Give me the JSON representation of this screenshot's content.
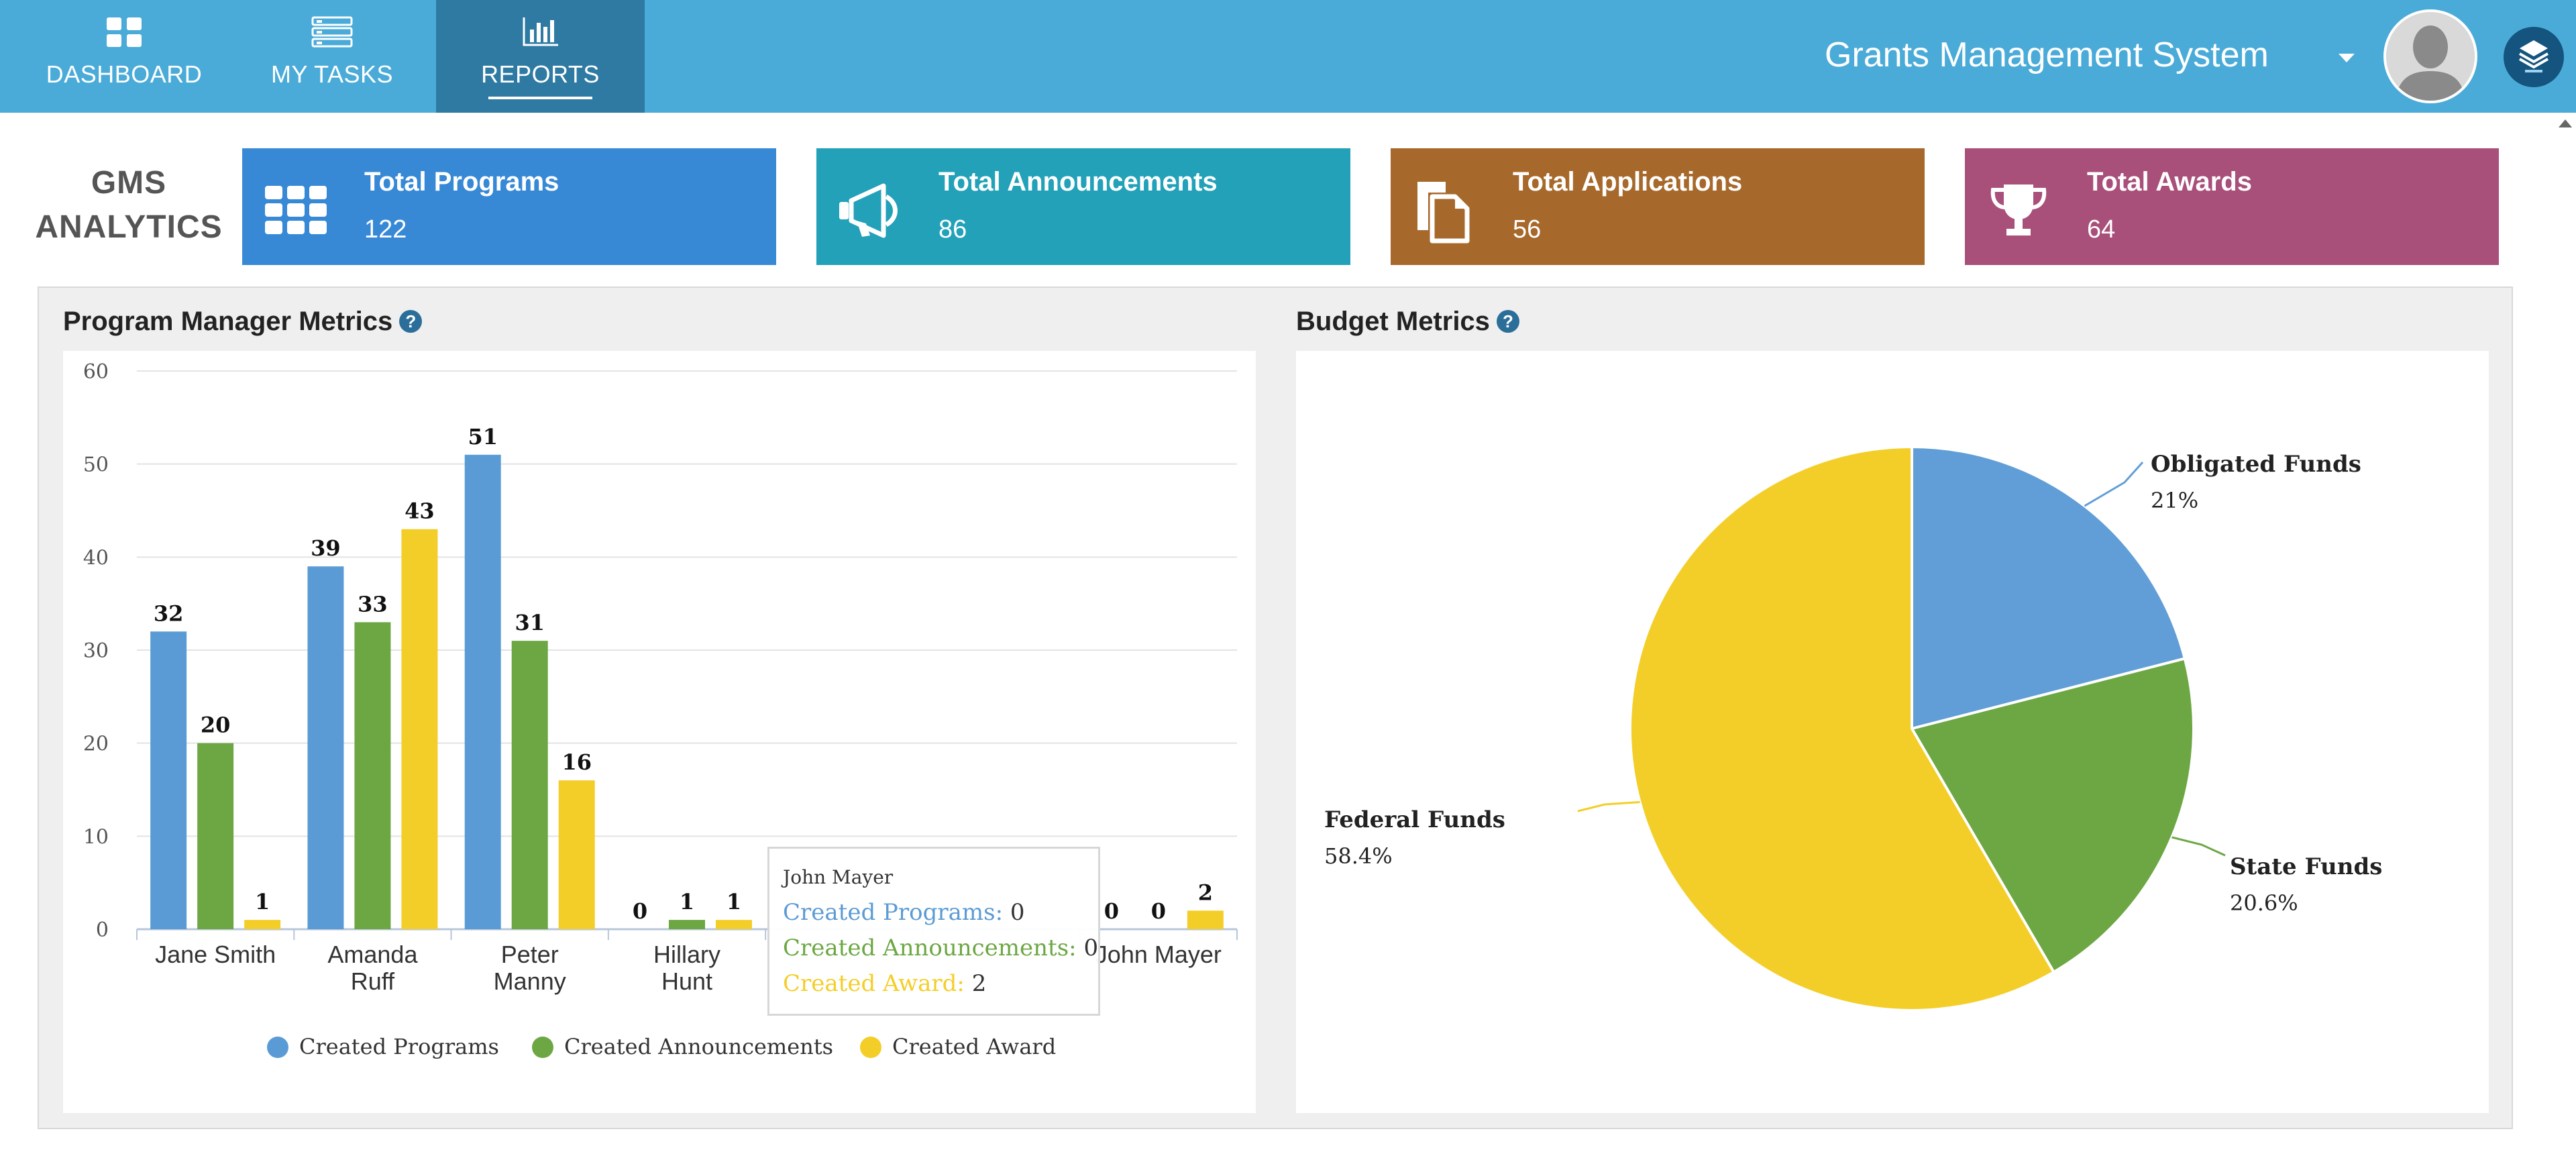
{
  "nav": {
    "items": [
      {
        "label": "DASHBOARD",
        "icon": "dashboard-grid-icon",
        "active": false
      },
      {
        "label": "MY TASKS",
        "icon": "task-list-icon",
        "active": false
      },
      {
        "label": "REPORTS",
        "icon": "bar-chart-icon",
        "active": true
      }
    ],
    "app_title": "Grants Management System"
  },
  "analytics": {
    "heading_line1": "GMS",
    "heading_line2": "ANALYTICS",
    "tiles": [
      {
        "title": "Total Programs",
        "value": "122",
        "icon": "grid-icon",
        "color": "#3789d6"
      },
      {
        "title": "Total Announcements",
        "value": "86",
        "icon": "megaphone-icon",
        "color": "#22a1b9"
      },
      {
        "title": "Total Applications",
        "value": "56",
        "icon": "documents-icon",
        "color": "#a7692b"
      },
      {
        "title": "Total Awards",
        "value": "64",
        "icon": "trophy-icon",
        "color": "#a84f7a"
      }
    ]
  },
  "program_metrics": {
    "title": "Program Manager Metrics",
    "tooltip": {
      "title": "John Mayer",
      "lines": [
        {
          "label": "Created Programs:",
          "value": "0"
        },
        {
          "label": "Created Announcements:",
          "value": "0"
        },
        {
          "label": "Created Award:",
          "value": "2"
        }
      ]
    }
  },
  "budget_metrics": {
    "title": "Budget Metrics"
  },
  "colors": {
    "programs": "#5b9bd5",
    "announcements": "#6ca743",
    "award": "#f4ce28",
    "federal": "#f4ce28",
    "obligated": "#619ed7",
    "state": "#6ca743"
  },
  "chart_data": [
    {
      "type": "bar",
      "title": "Program Manager Metrics",
      "categories": [
        [
          "Jane Smith"
        ],
        [
          "Amanda",
          "Ruff"
        ],
        [
          "Peter",
          "Manny"
        ],
        [
          "Hillary",
          "Hunt"
        ],
        [
          ""
        ],
        [
          ""
        ],
        [
          "John Mayer"
        ]
      ],
      "series": [
        {
          "name": "Created Programs",
          "values": [
            32,
            39,
            51,
            0,
            null,
            null,
            0
          ]
        },
        {
          "name": "Created Announcements",
          "values": [
            20,
            33,
            31,
            1,
            null,
            null,
            0
          ]
        },
        {
          "name": "Created Award",
          "values": [
            1,
            43,
            16,
            1,
            null,
            null,
            2
          ]
        }
      ],
      "ylim": [
        0,
        60
      ],
      "yticks": [
        0,
        10,
        20,
        30,
        40,
        50,
        60
      ],
      "grid": true,
      "legend": "bottom"
    },
    {
      "type": "pie",
      "title": "Budget Metrics",
      "slices": [
        {
          "name": "Obligated Funds",
          "value": 21,
          "label": "21%"
        },
        {
          "name": "State Funds",
          "value": 20.6,
          "label": "20.6%"
        },
        {
          "name": "Federal Funds",
          "value": 58.4,
          "label": "58.4%"
        }
      ]
    }
  ]
}
